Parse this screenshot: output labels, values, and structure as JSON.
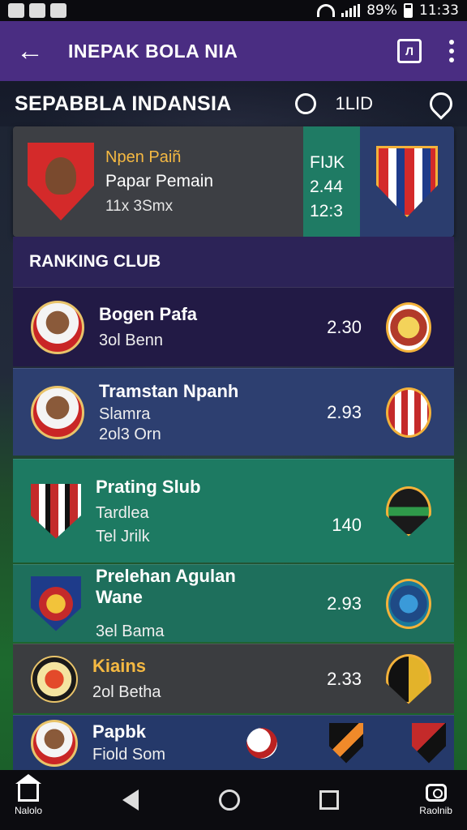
{
  "statusbar": {
    "battery": "89%",
    "time": "11:33"
  },
  "appbar": {
    "title": "INEPAK BOLA NIA",
    "square_label": "Л"
  },
  "subheader": {
    "title": "SEPABBLA INDANSIA",
    "center_text": "1LID"
  },
  "topcard": {
    "line1": "Npen Paiñ",
    "line2": "Papar Pemain",
    "line3": "11x 3Smx",
    "mid_label": "FIJK",
    "mid_value1": "2.44",
    "mid_value2": "12:3"
  },
  "ranking": {
    "title": "RANKING CLUB"
  },
  "rows": [
    {
      "name": "Bogen Pafa",
      "sub": "3ol Benn",
      "value": "2.30"
    },
    {
      "name": "Tramstan Npanh",
      "sub2": "Slamra",
      "sub": "2ol3 Orn",
      "value": "2.93"
    },
    {
      "name": "Prating Slub",
      "sub2": "Tardlea",
      "sub": "Tel Jrilk",
      "value": "140"
    },
    {
      "name": "Prelehan Agulan Wane",
      "sub": "3el Bama",
      "value": "2.93"
    },
    {
      "name": "Kiains",
      "sub": "2ol Betha",
      "value": "2.33"
    },
    {
      "name": "Papbk",
      "sub": "Fiold Som"
    }
  ],
  "navbar": {
    "left_label": "Nalolo",
    "right_label": "Raolnib"
  },
  "colors": {
    "appbar": "#4a2d82",
    "accent_gold": "#f3b23a",
    "teal": "#1d7a62"
  },
  "icons": [
    "back-arrow-icon",
    "square-icon",
    "more-icon",
    "timer-icon",
    "location-icon",
    "home-icon",
    "back-icon",
    "circle-home-icon",
    "recent-icon",
    "camera-icon"
  ]
}
